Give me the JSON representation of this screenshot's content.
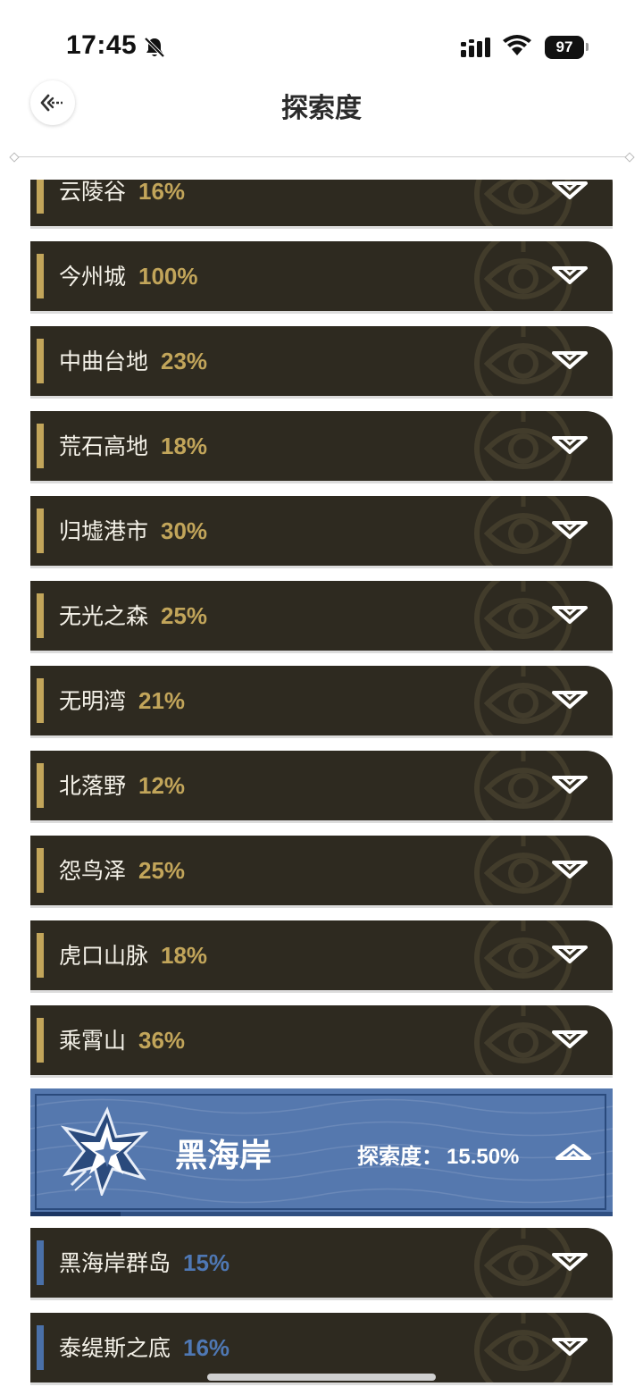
{
  "status_bar": {
    "time": "17:45",
    "battery": "97"
  },
  "header": {
    "title": "探索度"
  },
  "areas_top": [
    {
      "name": "云陵谷",
      "percent": "16%"
    },
    {
      "name": "今州城",
      "percent": "100%"
    },
    {
      "name": "中曲台地",
      "percent": "23%"
    },
    {
      "name": "荒石高地",
      "percent": "18%"
    },
    {
      "name": "归墟港市",
      "percent": "30%"
    },
    {
      "name": "无光之森",
      "percent": "25%"
    },
    {
      "name": "无明湾",
      "percent": "21%"
    },
    {
      "name": "北落野",
      "percent": "12%"
    },
    {
      "name": "怨鸟泽",
      "percent": "25%"
    },
    {
      "name": "虎口山脉",
      "percent": "18%"
    },
    {
      "name": "乘霄山",
      "percent": "36%"
    }
  ],
  "region": {
    "name": "黑海岸",
    "label": "探索度：",
    "percent": "15.50%",
    "progress_fraction": 0.155,
    "icon": "star-emblem-icon",
    "color": "#5578ae"
  },
  "areas_bottom": [
    {
      "name": "黑海岸群岛",
      "percent": "15%"
    },
    {
      "name": "泰缇斯之底",
      "percent": "16%"
    }
  ],
  "colors": {
    "gold_accent": "#c2a55a",
    "blue_accent": "#4a70a8",
    "row_bg": "#2e2a20"
  }
}
